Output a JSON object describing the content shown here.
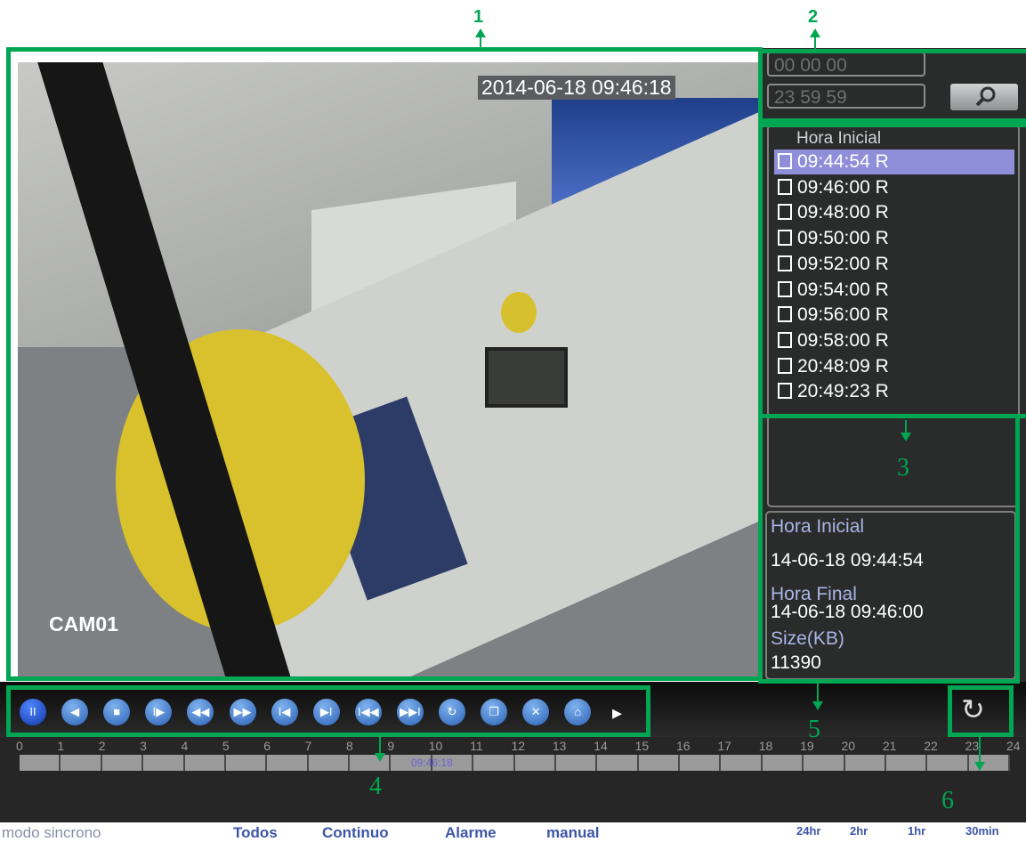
{
  "video": {
    "timestamp": "2014-06-18 09:46:18",
    "camera_label": "CAM01"
  },
  "search": {
    "start_time": "00 00 00",
    "end_time": "23 59 59",
    "button_icon": "magnifier-icon"
  },
  "file_list": {
    "header": "Hora Inicial",
    "selected_index": 0,
    "items": [
      "09:44:54  R",
      "09:46:00  R",
      "09:48:00  R",
      "09:50:00  R",
      "09:52:00  R",
      "09:54:00  R",
      "09:56:00  R",
      "09:58:00  R",
      "20:48:09  R",
      "20:49:23  R"
    ]
  },
  "file_info": {
    "start_label": "Hora Inicial",
    "start_value": "14-06-18 09:44:54",
    "end_label": "Hora Final",
    "end_value": "14-06-18 09:46:00",
    "size_label": "Size(KB)",
    "size_value": "11390"
  },
  "controls": [
    {
      "name": "pause",
      "glyph": "II"
    },
    {
      "name": "reverse-play",
      "glyph": "◀"
    },
    {
      "name": "stop",
      "glyph": "■"
    },
    {
      "name": "slow-play",
      "glyph": "I▶"
    },
    {
      "name": "rewind",
      "glyph": "◀◀"
    },
    {
      "name": "fast-forward",
      "glyph": "▶▶"
    },
    {
      "name": "previous-frame",
      "glyph": "I◀"
    },
    {
      "name": "next-frame",
      "glyph": "▶I"
    },
    {
      "name": "previous-file",
      "glyph": "I◀◀"
    },
    {
      "name": "next-file",
      "glyph": "▶▶I"
    },
    {
      "name": "loop",
      "glyph": "↻"
    },
    {
      "name": "fullscreen",
      "glyph": "❐"
    },
    {
      "name": "hide-panel",
      "glyph": "✕"
    },
    {
      "name": "backup",
      "glyph": "⌂"
    }
  ],
  "more_arrow": "▸",
  "refresh_icon": "↻",
  "timeline": {
    "hours": [
      "0",
      "1",
      "2",
      "3",
      "4",
      "5",
      "6",
      "7",
      "8",
      "9",
      "10",
      "11",
      "12",
      "13",
      "14",
      "15",
      "16",
      "17",
      "18",
      "19",
      "20",
      "21",
      "22",
      "23",
      "24"
    ],
    "current_time": "09:46:18"
  },
  "modes": [
    "modo sincrono",
    "Todos",
    "Continuo",
    "Alarme",
    "manual"
  ],
  "zoom_options": [
    "24hr",
    "2hr",
    "1hr",
    "30min"
  ],
  "annotations": [
    "1",
    "2",
    "3",
    "4",
    "5",
    "6"
  ],
  "colors": {
    "annotation_green": "#00a651",
    "selected_row": "#8f8fd9",
    "button_blue": "#2b62b6",
    "panel_dark": "#2a2b2b"
  }
}
